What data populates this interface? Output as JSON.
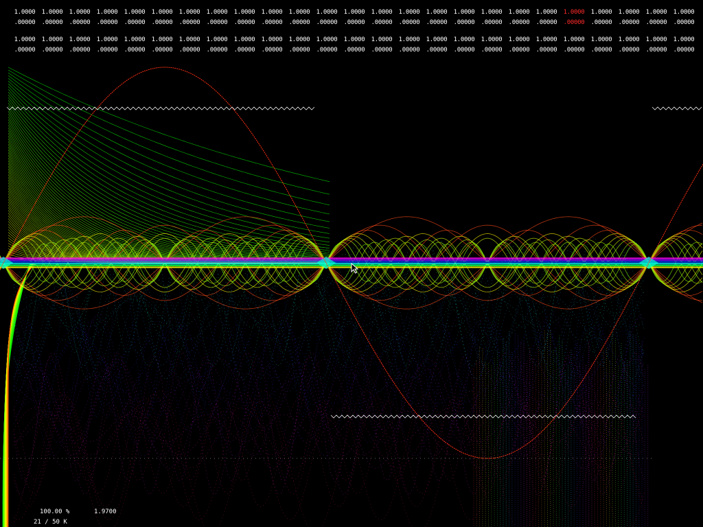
{
  "coefficients": {
    "rows": [
      {
        "top": [
          "1.0000",
          "1.0000",
          "1.0000",
          "1.0000",
          "1.0000",
          "1.0000",
          "1.0000",
          "1.0000",
          "1.0000",
          "1.0000",
          "1.0000",
          "1.0000",
          "1.0000",
          "1.0000",
          "1.0000",
          "1.0000",
          "1.0000",
          "1.0000",
          "1.0000",
          "1.0000",
          "1.0000",
          "1.0000",
          "1.0000",
          "1.0000",
          "1.0000"
        ],
        "bottom": [
          ".00000",
          ".00000",
          ".00000",
          ".00000",
          ".00000",
          ".00000",
          ".00000",
          ".00000",
          ".00000",
          ".00000",
          ".00000",
          ".00000",
          ".00000",
          ".00000",
          ".00000",
          ".00000",
          ".00000",
          ".00000",
          ".00000",
          ".00000",
          ".00000",
          ".00000",
          ".00000",
          ".00000",
          ".00000"
        ]
      },
      {
        "top": [
          "1.0000",
          "1.0000",
          "1.0000",
          "1.0000",
          "1.0000",
          "1.0000",
          "1.0000",
          "1.0000",
          "1.0000",
          "1.0000",
          "1.0000",
          "1.0000",
          "1.0000",
          "1.0000",
          "1.0000",
          "1.0000",
          "1.0000",
          "1.0000",
          "1.0000",
          "1.0000",
          "1.0000",
          "1.0000",
          "1.0000",
          "1.0000",
          "1.0000"
        ],
        "bottom": [
          ".00000",
          ".00000",
          ".00000",
          ".00000",
          ".00000",
          ".00000",
          ".00000",
          ".00000",
          ".00000",
          ".00000",
          ".00000",
          ".00000",
          ".00000",
          ".00000",
          ".00000",
          ".00000",
          ".00000",
          ".00000",
          ".00000",
          ".00000",
          ".00000",
          ".00000",
          ".00000",
          ".00000",
          ".00000"
        ]
      }
    ],
    "selected_index": 20,
    "selected_color": "#ff2a2a"
  },
  "status": {
    "percent": "100.00 %",
    "value": "1.9700",
    "count": "21 / 50 K"
  },
  "colors": {
    "background": "#000000",
    "text": "#ffffff",
    "fundamental_wave": "#ff3010"
  }
}
